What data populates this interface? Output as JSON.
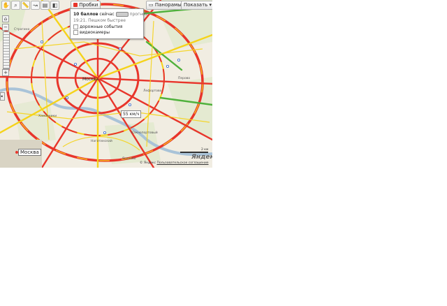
{
  "toolbar": {
    "traffic_label": "Пробки",
    "panoramas_label": "Панорамы",
    "show_label": "Показать"
  },
  "traffic_popup": {
    "score": "10 баллов",
    "now": "сейчас",
    "forecast": "прогноз",
    "updated": "19:21. Пешком быстрее",
    "option_events": "дорожные события",
    "option_cameras": "видеокамеры"
  },
  "map": {
    "speed_label": "55 км/ч",
    "city_label": "Москва",
    "logo": "Яндекс",
    "scale": "2 км",
    "copyright": "© Яндекс",
    "agreement": "Пользовательское соглашение",
    "place_labels": [
      "Москва",
      "Хамовники",
      "Нагатинский",
      "Ясенево",
      "Строгино",
      "Перово",
      "Лефортово",
      "Южнопортовый"
    ],
    "colors": {
      "jam": "#e8352b",
      "slow": "#f5d31a",
      "free": "#4fb13c",
      "road_bg": "#f4f1e8"
    }
  }
}
